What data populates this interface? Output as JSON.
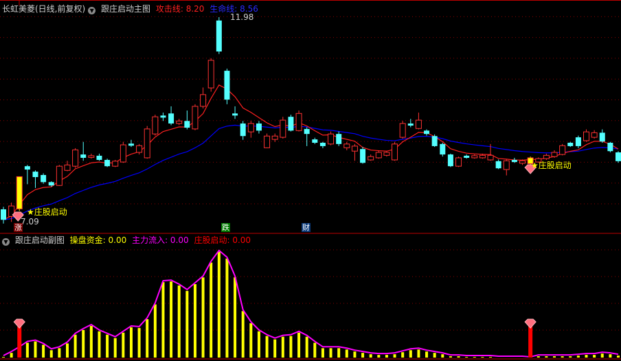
{
  "main_header": {
    "stock": "长虹美菱(日线,前复权)",
    "indicator": "跟庄启动主图",
    "attack_label": "攻击线: 8.20",
    "life_label": "生命线: 8.56"
  },
  "sub_header": {
    "indicator": "跟庄启动副图",
    "fund_label": "操盘资金: 0.00",
    "inflow_label": "主力流入: 0.00",
    "start_label": "庄股启动: 0.00"
  },
  "labels": {
    "high": "11.98",
    "low": "7.09",
    "signal_text": "庄股启动",
    "mark_up": "涨",
    "mark_down": "跌",
    "mark_cai": "财"
  },
  "colors": {
    "up": "#ff3232",
    "down": "#54ffff",
    "limit": "#ffff00",
    "attack": "#ff2020",
    "life": "#0000ff",
    "grid": "#8b0000",
    "fund": "#ffff00",
    "inflow": "#ff00ff",
    "signal": "#ff0000"
  },
  "chart_data": {
    "type": "candlestick",
    "ylim": [
      7.0,
      12.1
    ],
    "candles": [
      [
        7.39,
        7.14,
        7.45,
        7.05
      ],
      [
        7.22,
        7.47,
        7.55,
        7.09
      ],
      [
        7.4,
        8.17,
        8.17,
        7.35
      ],
      [
        8.42,
        8.34,
        8.45,
        7.99
      ],
      [
        8.29,
        8.16,
        8.32,
        7.9
      ],
      [
        8.21,
        8.04,
        8.25,
        8.0
      ],
      [
        8.04,
        7.96,
        8.06,
        7.93
      ],
      [
        7.96,
        8.42,
        8.45,
        7.95
      ],
      [
        8.32,
        8.45,
        8.55,
        8.3
      ],
      [
        8.42,
        8.81,
        8.85,
        8.38
      ],
      [
        8.7,
        8.62,
        9.0,
        8.55
      ],
      [
        8.63,
        8.67,
        8.72,
        8.6
      ],
      [
        8.67,
        8.57,
        8.72,
        8.55
      ],
      [
        8.57,
        8.42,
        8.6,
        8.4
      ],
      [
        8.42,
        8.54,
        8.57,
        8.4
      ],
      [
        8.52,
        8.93,
        9.0,
        8.5
      ],
      [
        8.96,
        8.91,
        9.05,
        8.88
      ],
      [
        8.75,
        8.91,
        8.95,
        8.7
      ],
      [
        8.62,
        9.31,
        9.38,
        8.6
      ],
      [
        9.19,
        9.6,
        9.65,
        9.15
      ],
      [
        9.63,
        9.58,
        9.7,
        9.5
      ],
      [
        9.68,
        9.44,
        9.85,
        9.4
      ],
      [
        9.44,
        9.5,
        9.55,
        9.4
      ],
      [
        9.5,
        9.34,
        9.75,
        9.3
      ],
      [
        9.31,
        9.85,
        9.9,
        9.28
      ],
      [
        9.85,
        10.13,
        10.3,
        9.8
      ],
      [
        10.29,
        10.95,
        11.0,
        10.2
      ],
      [
        11.9,
        11.16,
        11.98,
        11.1
      ],
      [
        10.7,
        10.01,
        10.75,
        9.9
      ],
      [
        9.68,
        9.63,
        9.85,
        9.55
      ],
      [
        9.44,
        9.14,
        9.5,
        9.05
      ],
      [
        9.24,
        9.44,
        9.5,
        9.1
      ],
      [
        9.44,
        9.27,
        9.5,
        9.2
      ],
      [
        8.86,
        9.14,
        9.2,
        8.85
      ],
      [
        9.06,
        9.14,
        9.2,
        9.0
      ],
      [
        9.11,
        9.52,
        9.6,
        9.08
      ],
      [
        9.6,
        9.27,
        9.65,
        9.25
      ],
      [
        9.27,
        9.68,
        9.75,
        9.25
      ],
      [
        9.31,
        9.19,
        9.35,
        8.9
      ],
      [
        9.06,
        8.98,
        9.1,
        8.95
      ],
      [
        8.98,
        8.9,
        9.0,
        8.85
      ],
      [
        8.95,
        9.19,
        9.25,
        8.92
      ],
      [
        9.19,
        8.95,
        9.25,
        8.9
      ],
      [
        8.86,
        8.95,
        9.0,
        8.8
      ],
      [
        8.78,
        8.9,
        8.95,
        8.55
      ],
      [
        8.83,
        8.5,
        8.88,
        8.48
      ],
      [
        8.57,
        8.65,
        8.7,
        8.55
      ],
      [
        8.62,
        8.75,
        8.8,
        8.6
      ],
      [
        8.68,
        8.75,
        8.78,
        8.65
      ],
      [
        8.57,
        8.95,
        9.0,
        8.55
      ],
      [
        9.11,
        9.44,
        9.5,
        9.08
      ],
      [
        9.44,
        9.39,
        9.55,
        9.35
      ],
      [
        9.32,
        9.52,
        9.7,
        9.3
      ],
      [
        9.27,
        9.19,
        9.3,
        9.15
      ],
      [
        9.14,
        8.9,
        9.18,
        8.88
      ],
      [
        8.95,
        8.7,
        8.98,
        8.65
      ],
      [
        8.7,
        8.42,
        8.72,
        8.4
      ],
      [
        8.42,
        8.62,
        8.65,
        8.4
      ],
      [
        8.67,
        8.62,
        8.7,
        8.6
      ],
      [
        8.62,
        8.67,
        8.7,
        8.6
      ],
      [
        8.62,
        8.68,
        8.72,
        8.6
      ],
      [
        8.57,
        8.68,
        8.95,
        8.55
      ],
      [
        8.54,
        8.37,
        8.58,
        8.35
      ],
      [
        8.34,
        8.55,
        8.58,
        8.2
      ],
      [
        8.57,
        8.52,
        8.62,
        8.5
      ],
      [
        8.49,
        8.55,
        8.58,
        8.45
      ],
      [
        8.48,
        8.62,
        8.65,
        8.45
      ],
      [
        8.52,
        8.6,
        8.63,
        8.5
      ],
      [
        8.6,
        8.68,
        8.72,
        8.57
      ],
      [
        8.65,
        8.75,
        8.8,
        8.62
      ],
      [
        8.7,
        8.91,
        8.95,
        8.68
      ],
      [
        8.98,
        8.9,
        9.0,
        8.88
      ],
      [
        9.11,
        8.9,
        9.15,
        8.85
      ],
      [
        9.03,
        9.24,
        9.3,
        9.0
      ],
      [
        9.11,
        9.22,
        9.28,
        9.08
      ],
      [
        9.22,
        9.01,
        9.3,
        8.98
      ],
      [
        8.98,
        8.78,
        9.0,
        8.75
      ],
      [
        8.75,
        8.54,
        8.78,
        8.5
      ]
    ],
    "limit_up_index": [
      2,
      66
    ],
    "signal_index": [
      2,
      66
    ],
    "fund_values": [
      3,
      9,
      16,
      24,
      26,
      21,
      13,
      16,
      23,
      36,
      43,
      49,
      41,
      36,
      31,
      39,
      47,
      46,
      59,
      81,
      114,
      115,
      109,
      101,
      111,
      121,
      143,
      159,
      149,
      121,
      71,
      53,
      41,
      34,
      29,
      33,
      34,
      39,
      33,
      24,
      16,
      16,
      16,
      14,
      11,
      9,
      7,
      6,
      6,
      7,
      10,
      13,
      14,
      11,
      9,
      7,
      4,
      4,
      3,
      3,
      3,
      3,
      2,
      2,
      2,
      2,
      1,
      4,
      4,
      4,
      4,
      4,
      5,
      6,
      6,
      8,
      7,
      5
    ],
    "fund_ylim": [
      0,
      165
    ],
    "signal_bar_value": 53
  }
}
